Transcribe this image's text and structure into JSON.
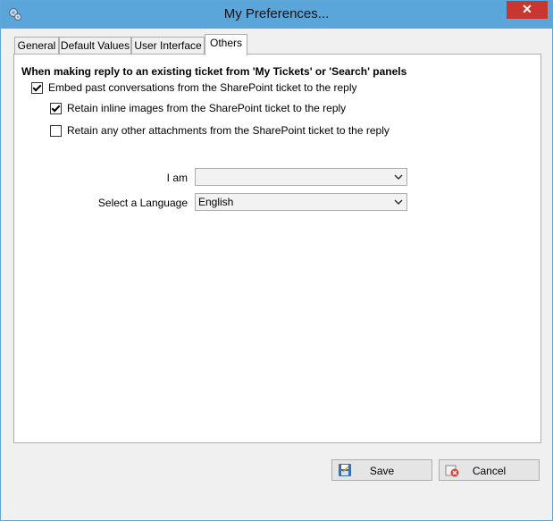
{
  "window": {
    "title": "My Preferences...",
    "close_glyph": "✕"
  },
  "tabs": [
    {
      "label": "General",
      "active": false
    },
    {
      "label": "Default Values",
      "active": false
    },
    {
      "label": "User Interface",
      "active": false
    },
    {
      "label": "Others",
      "active": true
    }
  ],
  "others": {
    "heading": "When making reply to an existing ticket from 'My Tickets' or 'Search' panels",
    "options": [
      {
        "label": "Embed past conversations from the SharePoint ticket to the reply",
        "checked": true
      },
      {
        "label": "Retain inline images from the SharePoint ticket to the reply",
        "checked": true
      },
      {
        "label": "Retain any other attachments from the SharePoint ticket to the reply",
        "checked": false
      }
    ],
    "i_am": {
      "label": "I am",
      "value": ""
    },
    "language": {
      "label": "Select a Language",
      "value": "English"
    }
  },
  "buttons": {
    "save_label": "Save",
    "cancel_label": "Cancel"
  },
  "icons": {
    "app": "gear-icon",
    "save": "save-icon",
    "cancel": "cancel-icon",
    "dropdown": "chevron-down-icon"
  },
  "colors": {
    "titlebar": "#5aa5d9",
    "close": "#c7372f",
    "face": "#f0f0f0"
  }
}
